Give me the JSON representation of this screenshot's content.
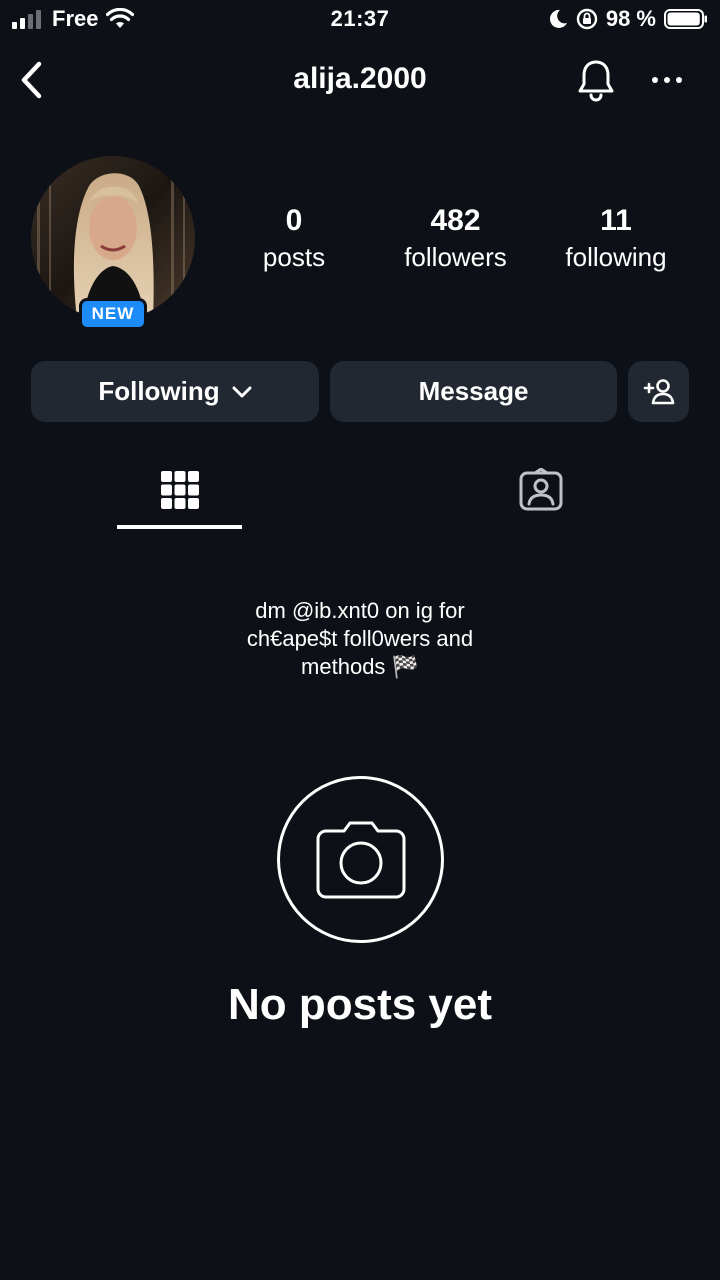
{
  "status_bar": {
    "carrier": "Free",
    "time": "21:37",
    "battery": "98 %",
    "battery_level": 0.98
  },
  "header": {
    "username": "alija.2000"
  },
  "profile": {
    "badge": "NEW",
    "stats": [
      {
        "value": "0",
        "label": "posts"
      },
      {
        "value": "482",
        "label": "followers"
      },
      {
        "value": "11",
        "label": "following"
      }
    ]
  },
  "actions": {
    "following_label": "Following",
    "message_label": "Message"
  },
  "bio": {
    "line1": "dm @ib.xnt0 on ig for",
    "line2": "ch€ape$t foll0wers and",
    "line3": "methods 🏁"
  },
  "empty_state": {
    "title": "No posts yet"
  },
  "icons": {
    "back": "chevron-left-icon",
    "bell": "bell-icon",
    "more": "more-horizontal-icon",
    "add_user": "add-user-icon",
    "grid": "grid-icon",
    "tagged": "tagged-person-icon",
    "camera": "camera-icon"
  },
  "colors": {
    "background": "#0d1117",
    "button": "#222831",
    "badge": "#1d8cf8"
  }
}
